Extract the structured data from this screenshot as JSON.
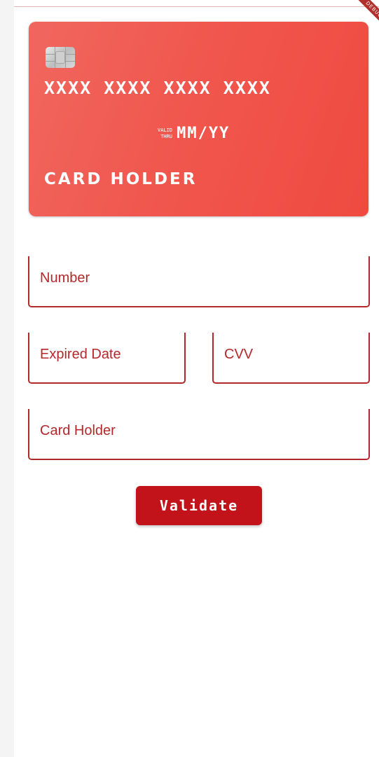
{
  "debug_banner": {
    "label": "DEBUG"
  },
  "card": {
    "number": "XXXX XXXX XXXX XXXX",
    "valid_label_top": "VALID",
    "valid_label_bottom": "THRU",
    "expiry": "MM/YY",
    "holder": "CARD HOLDER",
    "chip_icon": "card-chip-icon",
    "colors": {
      "gradient_start": "#f0675f",
      "gradient_end": "#ef4a40"
    }
  },
  "form": {
    "number_label": "Number",
    "expiry_label": "Expired Date",
    "cvv_label": "CVV",
    "holder_label": "Card Holder",
    "border_color": "#b3292b"
  },
  "actions": {
    "validate_label": "Validate",
    "button_color": "#c2131a"
  }
}
